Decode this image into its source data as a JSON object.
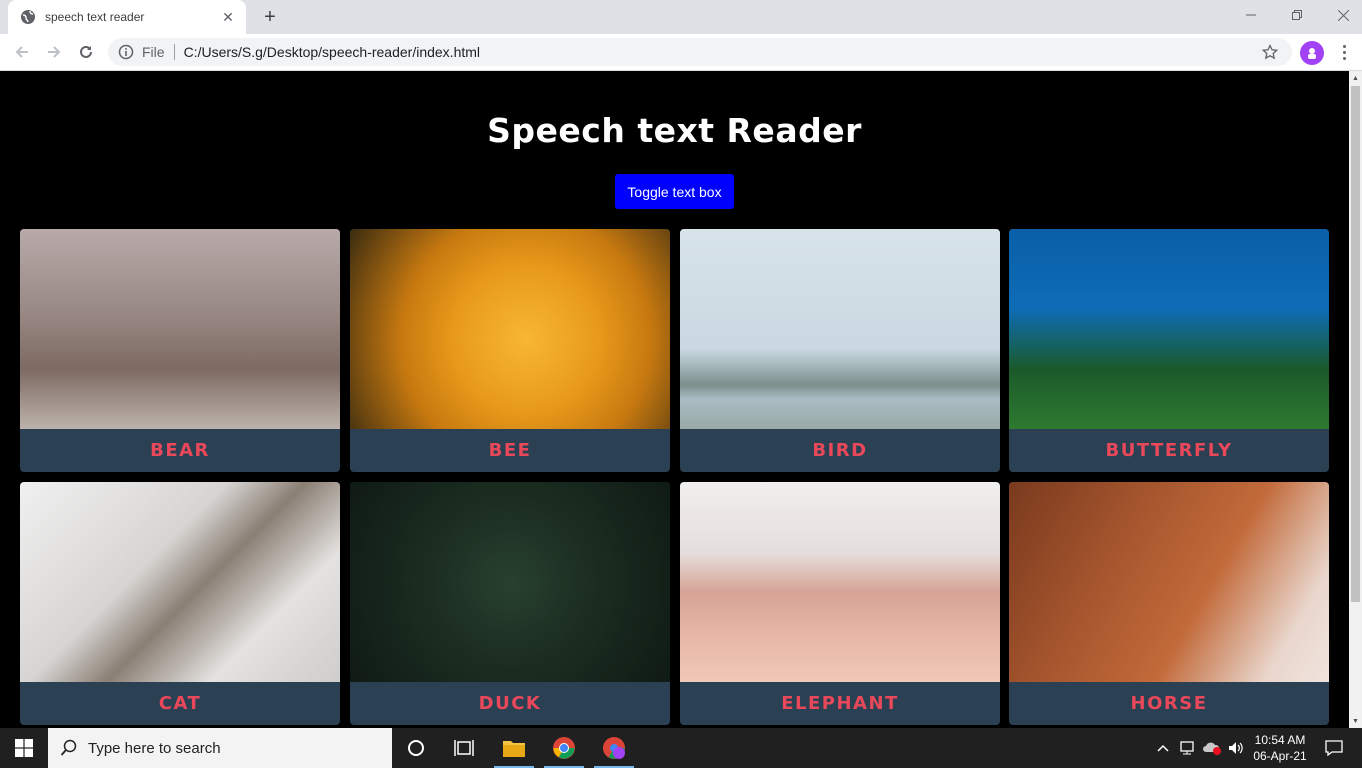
{
  "browser": {
    "tab_title": "speech text reader",
    "url_scheme": "File",
    "url": "C:/Users/S.g/Desktop/speech-reader/index.html"
  },
  "page": {
    "title": "Speech text Reader",
    "toggle_label": "Toggle text box",
    "cards": [
      {
        "label": "BEAR"
      },
      {
        "label": "BEE"
      },
      {
        "label": "BIRD"
      },
      {
        "label": "BUTTERFLY"
      },
      {
        "label": "CAT"
      },
      {
        "label": "DUCK"
      },
      {
        "label": "ELEPHANT"
      },
      {
        "label": "HORSE"
      }
    ]
  },
  "taskbar": {
    "search_placeholder": "Type here to search",
    "time": "10:54 AM",
    "date": "06-Apr-21"
  },
  "colors": {
    "toggle_button": "#0000ff",
    "card_label_bg": "#2b4053",
    "card_label_text": "#e8485a",
    "page_background": "#000000"
  }
}
